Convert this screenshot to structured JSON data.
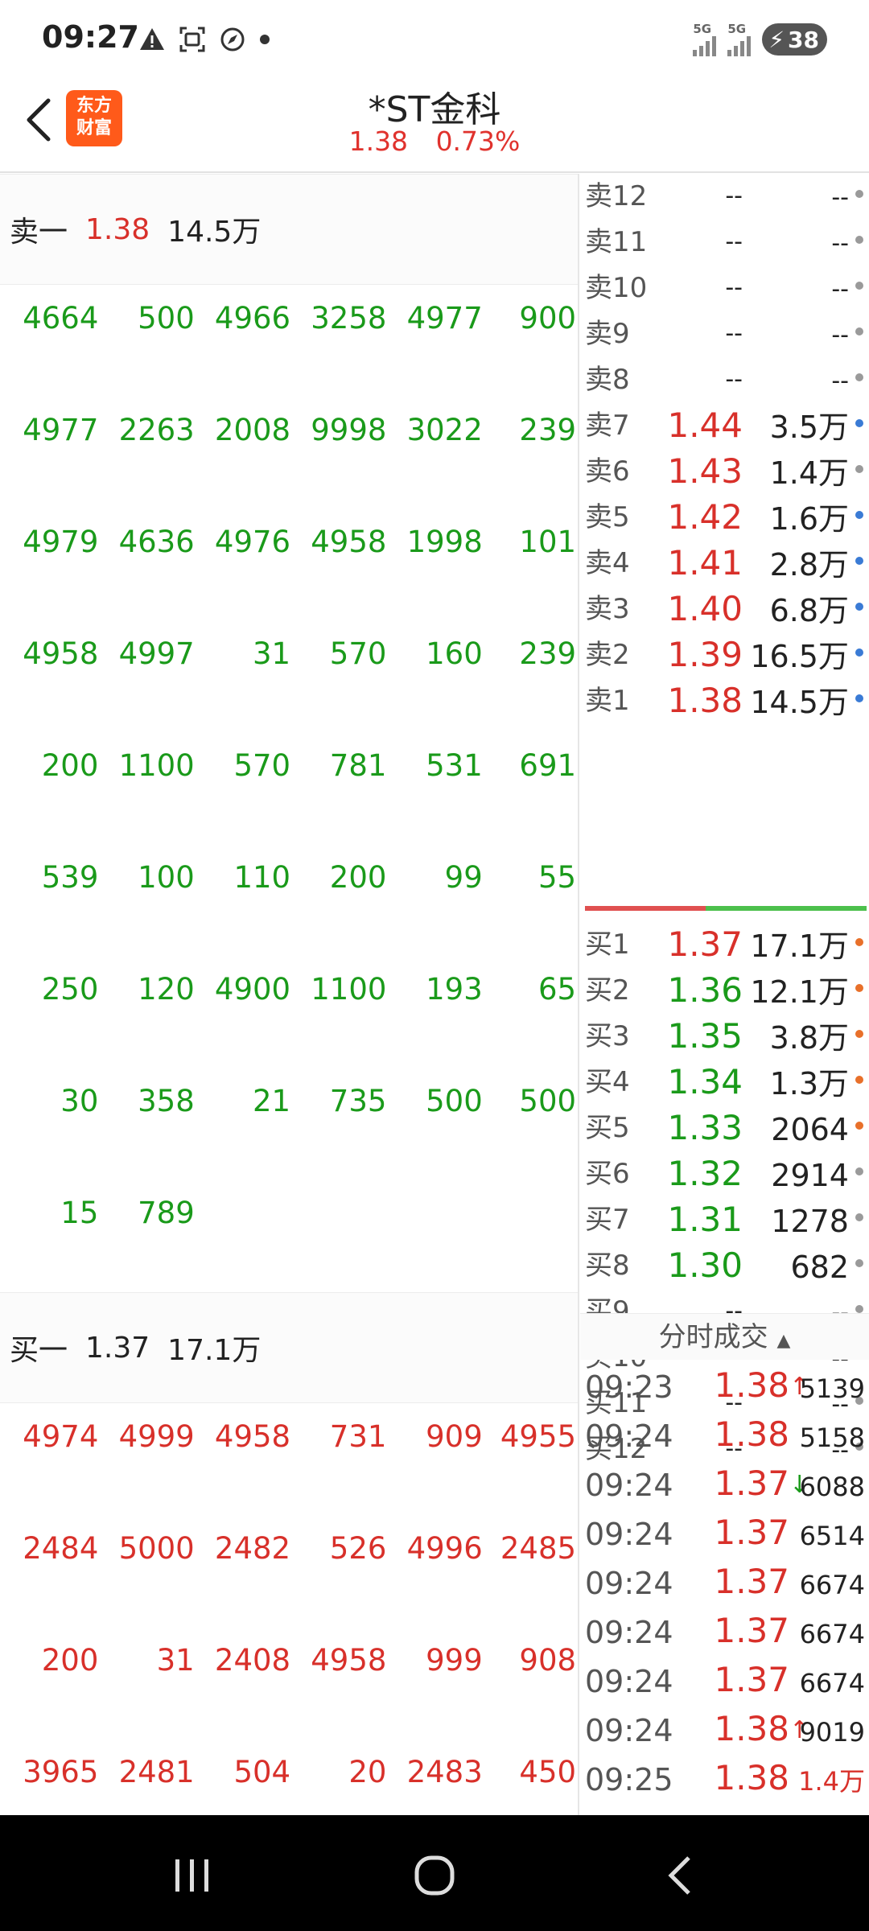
{
  "status_bar": {
    "time": "09:27",
    "sig1_label": "5G",
    "sig2_label": "5G",
    "battery": "38",
    "icons": [
      "alert-icon",
      "screenshot-icon",
      "compass-icon",
      "dot-icon"
    ]
  },
  "header": {
    "logo_line1": "东方",
    "logo_line2": "财富",
    "stock_name": "*ST金科",
    "price": "1.38",
    "change_pct": "0.73%"
  },
  "left": {
    "sell_row": {
      "label": "卖一",
      "price": "1.38",
      "volume": "14.5万"
    },
    "buy_row": {
      "label": "买一",
      "price": "1.37",
      "volume": "17.1万"
    },
    "sell_queue": [
      [
        "4664",
        "500",
        "4966",
        "3258",
        "4977",
        "900"
      ],
      [
        "4977",
        "2263",
        "2008",
        "9998",
        "3022",
        "239"
      ],
      [
        "4979",
        "4636",
        "4976",
        "4958",
        "1998",
        "101"
      ],
      [
        "4958",
        "4997",
        "31",
        "570",
        "160",
        "239"
      ],
      [
        "200",
        "1100",
        "570",
        "781",
        "531",
        "691"
      ],
      [
        "539",
        "100",
        "110",
        "200",
        "99",
        "55"
      ],
      [
        "250",
        "120",
        "4900",
        "1100",
        "193",
        "65"
      ],
      [
        "30",
        "358",
        "21",
        "735",
        "500",
        "500"
      ],
      [
        "15",
        "789",
        "",
        "",
        "",
        ""
      ]
    ],
    "buy_queue": [
      [
        "4974",
        "4999",
        "4958",
        "731",
        "909",
        "4955"
      ],
      [
        "2484",
        "5000",
        "2482",
        "526",
        "4996",
        "2485"
      ],
      [
        "200",
        "31",
        "2408",
        "4958",
        "999",
        "908"
      ],
      [
        "3965",
        "2481",
        "504",
        "20",
        "2483",
        "450"
      ]
    ]
  },
  "order_book": {
    "asks": [
      {
        "label": "卖12",
        "price": "--",
        "volume": "--",
        "dot": "#9a9a9a"
      },
      {
        "label": "卖11",
        "price": "--",
        "volume": "--",
        "dot": "#9a9a9a"
      },
      {
        "label": "卖10",
        "price": "--",
        "volume": "--",
        "dot": "#9a9a9a"
      },
      {
        "label": "卖9",
        "price": "--",
        "volume": "--",
        "dot": "#9a9a9a"
      },
      {
        "label": "卖8",
        "price": "--",
        "volume": "--",
        "dot": "#9a9a9a"
      },
      {
        "label": "卖7",
        "price": "1.44",
        "volume": "3.5万",
        "dot": "#3a7bd5"
      },
      {
        "label": "卖6",
        "price": "1.43",
        "volume": "1.4万",
        "dot": "#9a9a9a"
      },
      {
        "label": "卖5",
        "price": "1.42",
        "volume": "1.6万",
        "dot": "#3a7bd5"
      },
      {
        "label": "卖4",
        "price": "1.41",
        "volume": "2.8万",
        "dot": "#3a7bd5"
      },
      {
        "label": "卖3",
        "price": "1.40",
        "volume": "6.8万",
        "dot": "#3a7bd5"
      },
      {
        "label": "卖2",
        "price": "1.39",
        "volume": "16.5万",
        "dot": "#3a7bd5"
      },
      {
        "label": "卖1",
        "price": "1.38",
        "volume": "14.5万",
        "dot": "#3a7bd5"
      }
    ],
    "bids": [
      {
        "label": "买1",
        "price": "1.37",
        "volume": "17.1万",
        "dot": "#e8702a"
      },
      {
        "label": "买2",
        "price": "1.36",
        "volume": "12.1万",
        "dot": "#e8702a"
      },
      {
        "label": "买3",
        "price": "1.35",
        "volume": "3.8万",
        "dot": "#e8702a"
      },
      {
        "label": "买4",
        "price": "1.34",
        "volume": "1.3万",
        "dot": "#e8702a"
      },
      {
        "label": "买5",
        "price": "1.33",
        "volume": "2064",
        "dot": "#e8702a"
      },
      {
        "label": "买6",
        "price": "1.32",
        "volume": "2914",
        "dot": "#9a9a9a"
      },
      {
        "label": "买7",
        "price": "1.31",
        "volume": "1278",
        "dot": "#9a9a9a"
      },
      {
        "label": "买8",
        "price": "1.30",
        "volume": "682",
        "dot": "#9a9a9a"
      },
      {
        "label": "买9",
        "price": "--",
        "volume": "--",
        "dot": "#9a9a9a"
      },
      {
        "label": "买10",
        "price": "--",
        "volume": "--",
        "dot": "#9a9a9a"
      },
      {
        "label": "买11",
        "price": "--",
        "volume": "--",
        "dot": "#9a9a9a"
      },
      {
        "label": "买12",
        "price": "--",
        "volume": "--",
        "dot": "#9a9a9a"
      }
    ]
  },
  "trades": {
    "header": "分时成交",
    "rows": [
      {
        "time": "09:23",
        "price": "1.38",
        "dir": "up",
        "volume": "5139"
      },
      {
        "time": "09:24",
        "price": "1.38",
        "dir": "",
        "volume": "5158"
      },
      {
        "time": "09:24",
        "price": "1.37",
        "dir": "down",
        "volume": "6088"
      },
      {
        "time": "09:24",
        "price": "1.37",
        "dir": "",
        "volume": "6514"
      },
      {
        "time": "09:24",
        "price": "1.37",
        "dir": "",
        "volume": "6674"
      },
      {
        "time": "09:24",
        "price": "1.37",
        "dir": "",
        "volume": "6674"
      },
      {
        "time": "09:24",
        "price": "1.37",
        "dir": "",
        "volume": "6674"
      },
      {
        "time": "09:24",
        "price": "1.38",
        "dir": "up",
        "volume": "9019"
      },
      {
        "time": "09:25",
        "price": "1.38",
        "dir": "",
        "volume": "1.4万"
      }
    ]
  },
  "colors": {
    "up": "#d8302a",
    "down": "#1a9a1a",
    "neutral": "#222222"
  }
}
